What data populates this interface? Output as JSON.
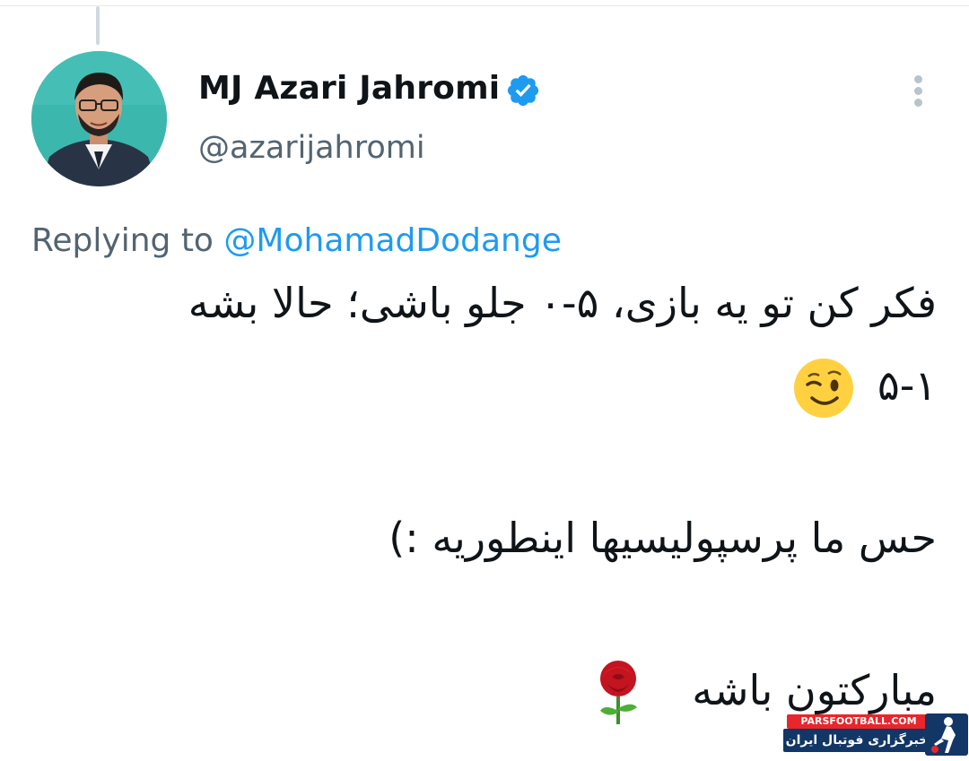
{
  "tweet": {
    "author": {
      "display_name": "MJ Azari Jahromi",
      "handle": "@azarijahromi",
      "verified": true,
      "verified_icon": "verified-badge-icon",
      "avatar": "avatar-photo"
    },
    "menu_icon": "more-vertical-icon",
    "reply": {
      "prefix": "Replying to",
      "mention": "@MohamadDodange"
    },
    "lines": [
      "فکر کن تو یه بازی، ۵-۰ جلو باشی؛ حالا بشه",
      "۵-۱",
      "حس ما پرسپولیسیها اینطوریه :)",
      "مبارکتون باشه"
    ],
    "emojis": [
      "winking-face-emoji",
      "rose-emoji"
    ]
  },
  "watermark": {
    "site": "PARSFOOTBALL.COM",
    "tagline": "خبرگزاری فوتبال ایران"
  },
  "colors": {
    "link": "#1d9bf0",
    "verified": "#1d9bf0",
    "secondary_text": "#536471",
    "watermark_red": "#e8262c",
    "watermark_blue": "#123766"
  }
}
